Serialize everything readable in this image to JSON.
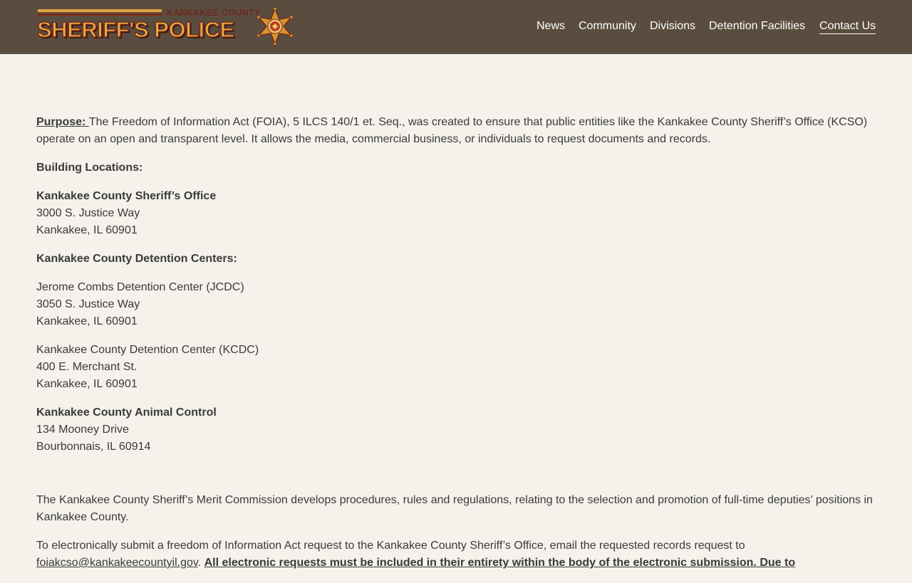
{
  "logo": {
    "county": "KANKAKEE COUNTY",
    "title": "SHERIFF'S POLICE",
    "star_icon": "sheriff-star-badge",
    "colors": {
      "gold": "#f0a940",
      "dark_red": "#6b2a1d"
    }
  },
  "nav": {
    "items": [
      "News",
      "Community",
      "Divisions",
      "Detention Facilities",
      "Contact Us"
    ],
    "active": "Contact Us"
  },
  "colors": {
    "header_bg": "#5a4d40",
    "page_bg": "#f5f2ec",
    "text": "#3a3a3a"
  },
  "content": {
    "purpose_label": "Purpose: ",
    "purpose_text": "The Freedom of Information Act (FOIA), 5 ILCS 140/1 et. Seq., was created to ensure that public entities like the Kankakee County Sheriff’s Office (KCSO) operate on an open and transparent level.  It allows the media, commercial business, or individuals to request documents and records.",
    "building_locations_heading": "Building Locations:",
    "sheriff_office": {
      "name": "Kankakee County Sheriff’s Office",
      "street": "3000 S. Justice Way",
      "city": "Kankakee, IL 60901"
    },
    "detention_heading": "Kankakee County Detention Centers:",
    "jcdc": {
      "name": "Jerome Combs Detention Center (JCDC)",
      "street": "3050 S. Justice Way",
      "city": "Kankakee, IL 60901"
    },
    "kcdc": {
      "name": "Kankakee County Detention Center (KCDC)",
      "street": "400 E. Merchant St.",
      "city": "Kankakee, IL 60901"
    },
    "animal_control": {
      "name": "Kankakee County Animal Control",
      "street": "134 Mooney Drive",
      "city": "Bourbonnais, IL 60914"
    },
    "merit_text": "The Kankakee County Sheriff’s Merit Commission develops procedures, rules and regulations, relating to the selection and promotion of full-time deputies’ positions in Kankakee County.",
    "submit_text": " To electronically submit a freedom of Information Act request to the Kankakee County Sheriff’s Office, email the requested records request to ",
    "email": "foiakcso@kankakeecountyil.gov",
    "after_email": ".  ",
    "electronic_note": "All electronic requests must be included in their entirety within the body of the electronic submission. Due to "
  }
}
